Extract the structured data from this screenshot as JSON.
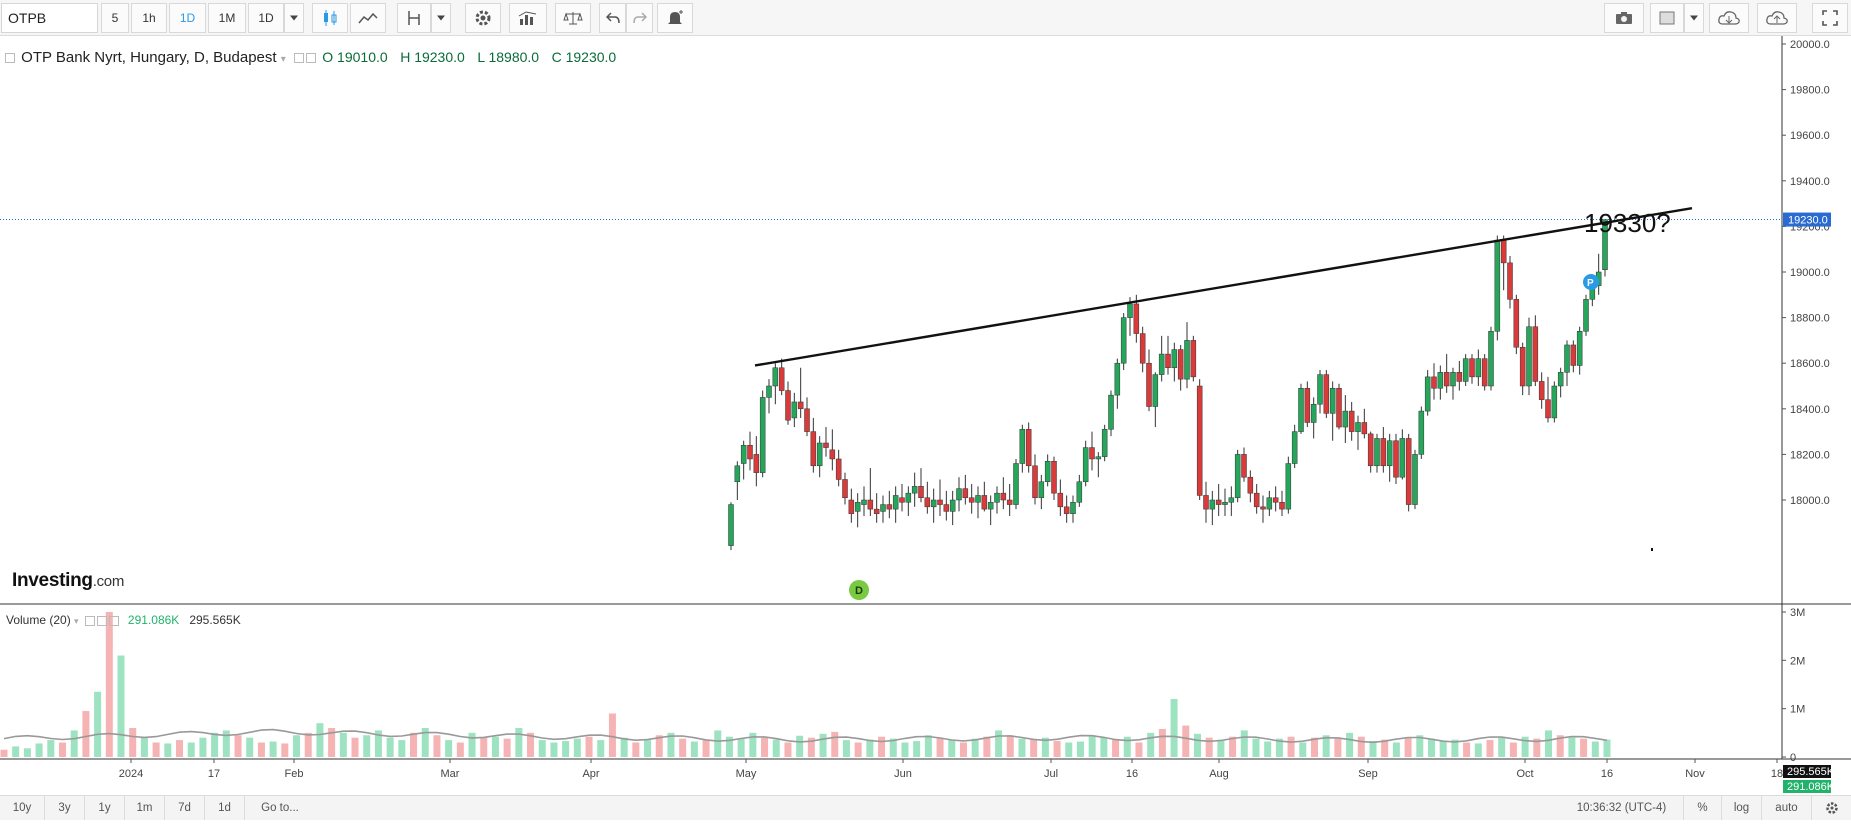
{
  "toolbar": {
    "symbol": "OTPB",
    "intervals": [
      "5",
      "1h",
      "1D",
      "1M",
      "1D"
    ],
    "active_interval": "1D"
  },
  "legend": {
    "title": "OTP Bank Nyrt, Hungary, D, Budapest",
    "open": "O 19010.0",
    "high": "H 19230.0",
    "low": "L 18980.0",
    "close": "C 19230.0"
  },
  "volume_legend": {
    "label": "Volume (20)",
    "value1": "291.086K",
    "value2": "295.565K"
  },
  "logo": {
    "main": "Investing",
    "suffix": ".com"
  },
  "annotation": "19330?",
  "bottombar": {
    "ranges": [
      "10y",
      "3y",
      "1y",
      "1m",
      "7d",
      "1d"
    ],
    "goto": "Go to...",
    "time": "10:36:32 (UTC-4)",
    "percent": "%",
    "log": "log",
    "auto": "auto"
  },
  "colors": {
    "up": "#26a65b",
    "down": "#d93b3b",
    "vol_up": "#9de3c1",
    "vol_down": "#f5b3b3",
    "current": "#2a6bd1"
  },
  "chart_data": {
    "type": "candlestick",
    "y_ticks": [
      "20000.0",
      "19800.0",
      "19600.0",
      "19400.0",
      "19200.0",
      "19000.0",
      "18800.0",
      "18600.0",
      "18400.0",
      "18200.0",
      "18000.0"
    ],
    "ylim": [
      17940,
      20050
    ],
    "current_price": "19230.0",
    "x_labels": [
      "2024",
      "17",
      "Feb",
      "Mar",
      "Apr",
      "May",
      "Jun",
      "Jul",
      "16",
      "Aug",
      "Sep",
      "Oct",
      "16",
      "Nov",
      "18"
    ],
    "volume_ticks": [
      "3M",
      "2M",
      "1M",
      "0"
    ],
    "volume_current": [
      "295.565K",
      "291.086K"
    ],
    "trendline": [
      [
        18590,
        0
      ],
      [
        19280,
        1
      ]
    ],
    "candles": [
      [
        17800,
        17990,
        17780,
        17980
      ],
      [
        18080,
        18170,
        18000,
        18150
      ],
      [
        18160,
        18260,
        18090,
        18240
      ],
      [
        18240,
        18300,
        18130,
        18180
      ],
      [
        18200,
        18280,
        18060,
        18120
      ],
      [
        18120,
        18480,
        18100,
        18450
      ],
      [
        18450,
        18530,
        18380,
        18500
      ],
      [
        18500,
        18600,
        18420,
        18580
      ],
      [
        18580,
        18620,
        18460,
        18480
      ],
      [
        18480,
        18520,
        18330,
        18350
      ],
      [
        18360,
        18470,
        18320,
        18430
      ],
      [
        18430,
        18580,
        18360,
        18400
      ],
      [
        18400,
        18450,
        18280,
        18300
      ],
      [
        18300,
        18360,
        18120,
        18150
      ],
      [
        18150,
        18280,
        18100,
        18250
      ],
      [
        18250,
        18320,
        18190,
        18230
      ],
      [
        18220,
        18310,
        18130,
        18180
      ],
      [
        18180,
        18220,
        18060,
        18090
      ],
      [
        18090,
        18120,
        17980,
        18010
      ],
      [
        18000,
        18050,
        17900,
        17940
      ],
      [
        17950,
        18030,
        17880,
        17990
      ],
      [
        17980,
        18060,
        17930,
        18000
      ],
      [
        18000,
        18140,
        17930,
        17960
      ],
      [
        17960,
        18030,
        17900,
        17940
      ],
      [
        17950,
        18020,
        17900,
        17980
      ],
      [
        17980,
        18040,
        17920,
        17960
      ],
      [
        17960,
        18060,
        17900,
        18020
      ],
      [
        18010,
        18070,
        17950,
        17990
      ],
      [
        17990,
        18060,
        17930,
        18030
      ],
      [
        18030,
        18120,
        17970,
        18060
      ],
      [
        18060,
        18140,
        17990,
        18010
      ],
      [
        18010,
        18080,
        17940,
        17970
      ],
      [
        17970,
        18050,
        17900,
        18000
      ],
      [
        18000,
        18090,
        17930,
        17980
      ],
      [
        17980,
        18040,
        17910,
        17950
      ],
      [
        17950,
        18040,
        17890,
        18000
      ],
      [
        18000,
        18100,
        17950,
        18050
      ],
      [
        18050,
        18110,
        17980,
        18010
      ],
      [
        18010,
        18070,
        17940,
        17990
      ],
      [
        17990,
        18060,
        17920,
        18020
      ],
      [
        18020,
        18080,
        17950,
        17960
      ],
      [
        17960,
        18020,
        17890,
        17990
      ],
      [
        17990,
        18060,
        17940,
        18030
      ],
      [
        18030,
        18100,
        17960,
        18000
      ],
      [
        18000,
        18070,
        17930,
        17980
      ],
      [
        17980,
        18180,
        17960,
        18160
      ],
      [
        18160,
        18330,
        18120,
        18310
      ],
      [
        18310,
        18340,
        18120,
        18150
      ],
      [
        18150,
        18200,
        17980,
        18010
      ],
      [
        18010,
        18110,
        17960,
        18080
      ],
      [
        18080,
        18200,
        18060,
        18170
      ],
      [
        18170,
        18190,
        18000,
        18030
      ],
      [
        18030,
        18090,
        17930,
        17970
      ],
      [
        17970,
        18020,
        17900,
        17940
      ],
      [
        17940,
        18020,
        17900,
        17990
      ],
      [
        17990,
        18110,
        17970,
        18080
      ],
      [
        18080,
        18260,
        18060,
        18230
      ],
      [
        18230,
        18300,
        18130,
        18180
      ],
      [
        18180,
        18210,
        18100,
        18190
      ],
      [
        18190,
        18330,
        18170,
        18310
      ],
      [
        18310,
        18480,
        18280,
        18460
      ],
      [
        18460,
        18620,
        18400,
        18600
      ],
      [
        18600,
        18820,
        18570,
        18800
      ],
      [
        18800,
        18890,
        18720,
        18860
      ],
      [
        18860,
        18900,
        18690,
        18730
      ],
      [
        18730,
        18760,
        18560,
        18600
      ],
      [
        18600,
        18660,
        18390,
        18410
      ],
      [
        18410,
        18560,
        18320,
        18550
      ],
      [
        18550,
        18720,
        18520,
        18640
      ],
      [
        18640,
        18720,
        18550,
        18580
      ],
      [
        18580,
        18690,
        18520,
        18660
      ],
      [
        18660,
        18680,
        18480,
        18530
      ],
      [
        18530,
        18780,
        18490,
        18700
      ],
      [
        18700,
        18720,
        18520,
        18540
      ],
      [
        18500,
        18530,
        18000,
        18020
      ],
      [
        18020,
        18080,
        17900,
        17960
      ],
      [
        17960,
        18040,
        17890,
        18000
      ],
      [
        18000,
        18070,
        17930,
        17980
      ],
      [
        17980,
        18050,
        17930,
        17990
      ],
      [
        17990,
        18060,
        17930,
        18010
      ],
      [
        18010,
        18220,
        17990,
        18200
      ],
      [
        18200,
        18230,
        18080,
        18100
      ],
      [
        18100,
        18130,
        17990,
        18030
      ],
      [
        18030,
        18070,
        17940,
        17970
      ],
      [
        17970,
        18020,
        17900,
        17960
      ],
      [
        17960,
        18040,
        17930,
        18010
      ],
      [
        18010,
        18060,
        17950,
        17990
      ],
      [
        17990,
        18040,
        17930,
        17960
      ],
      [
        17960,
        18190,
        17940,
        18160
      ],
      [
        18160,
        18330,
        18140,
        18300
      ],
      [
        18300,
        18510,
        18290,
        18490
      ],
      [
        18490,
        18520,
        18320,
        18340
      ],
      [
        18340,
        18450,
        18270,
        18420
      ],
      [
        18420,
        18570,
        18380,
        18550
      ],
      [
        18550,
        18570,
        18360,
        18380
      ],
      [
        18380,
        18520,
        18260,
        18490
      ],
      [
        18490,
        18510,
        18310,
        18320
      ],
      [
        18320,
        18460,
        18250,
        18390
      ],
      [
        18390,
        18430,
        18260,
        18300
      ],
      [
        18300,
        18370,
        18220,
        18340
      ],
      [
        18340,
        18400,
        18270,
        18290
      ],
      [
        18290,
        18300,
        18120,
        18150
      ],
      [
        18150,
        18290,
        18120,
        18270
      ],
      [
        18270,
        18320,
        18120,
        18150
      ],
      [
        18150,
        18290,
        18080,
        18260
      ],
      [
        18260,
        18290,
        18070,
        18100
      ],
      [
        18100,
        18310,
        18090,
        18270
      ],
      [
        18270,
        18290,
        17950,
        17980
      ],
      [
        17980,
        18220,
        17960,
        18200
      ],
      [
        18200,
        18410,
        18180,
        18390
      ],
      [
        18390,
        18570,
        18370,
        18540
      ],
      [
        18540,
        18600,
        18440,
        18490
      ],
      [
        18490,
        18590,
        18440,
        18560
      ],
      [
        18560,
        18640,
        18470,
        18500
      ],
      [
        18500,
        18580,
        18440,
        18560
      ],
      [
        18560,
        18610,
        18480,
        18520
      ],
      [
        18520,
        18640,
        18500,
        18620
      ],
      [
        18620,
        18640,
        18510,
        18540
      ],
      [
        18540,
        18660,
        18500,
        18620
      ],
      [
        18620,
        18640,
        18480,
        18500
      ],
      [
        18500,
        18760,
        18480,
        18740
      ],
      [
        18740,
        19160,
        18700,
        19140
      ],
      [
        19140,
        19160,
        18920,
        19040
      ],
      [
        19040,
        19070,
        18840,
        18880
      ],
      [
        18880,
        18900,
        18640,
        18670
      ],
      [
        18670,
        18690,
        18460,
        18500
      ],
      [
        18500,
        18800,
        18460,
        18760
      ],
      [
        18760,
        18810,
        18500,
        18520
      ],
      [
        18520,
        18560,
        18400,
        18440
      ],
      [
        18440,
        18540,
        18340,
        18360
      ],
      [
        18360,
        18520,
        18340,
        18500
      ],
      [
        18500,
        18580,
        18450,
        18560
      ],
      [
        18560,
        18700,
        18500,
        18680
      ],
      [
        18680,
        18700,
        18560,
        18590
      ],
      [
        18590,
        18760,
        18550,
        18740
      ],
      [
        18740,
        18900,
        18720,
        18880
      ],
      [
        18880,
        18960,
        18850,
        18940
      ],
      [
        18940,
        19080,
        18900,
        19000
      ],
      [
        19010,
        19230,
        18980,
        19230
      ]
    ],
    "volumes": [
      0.15,
      0.22,
      0.18,
      0.28,
      0.35,
      0.3,
      0.55,
      0.95,
      1.35,
      3.0,
      2.1,
      0.6,
      0.4,
      0.3,
      0.28,
      0.35,
      0.3,
      0.4,
      0.5,
      0.55,
      0.45,
      0.4,
      0.3,
      0.32,
      0.28,
      0.45,
      0.5,
      0.7,
      0.6,
      0.5,
      0.4,
      0.45,
      0.55,
      0.4,
      0.35,
      0.5,
      0.6,
      0.45,
      0.35,
      0.3,
      0.5,
      0.4,
      0.42,
      0.38,
      0.6,
      0.5,
      0.35,
      0.3,
      0.33,
      0.38,
      0.42,
      0.35,
      0.9,
      0.4,
      0.3,
      0.35,
      0.45,
      0.5,
      0.38,
      0.32,
      0.35,
      0.55,
      0.42,
      0.38,
      0.5,
      0.4,
      0.36,
      0.3,
      0.44,
      0.4,
      0.48,
      0.52,
      0.35,
      0.3,
      0.36,
      0.42,
      0.38,
      0.3,
      0.33,
      0.45,
      0.4,
      0.36,
      0.3,
      0.38,
      0.42,
      0.55,
      0.45,
      0.38,
      0.36,
      0.4,
      0.33,
      0.3,
      0.32,
      0.45,
      0.4,
      0.36,
      0.42,
      0.3,
      0.5,
      0.58,
      1.2,
      0.65,
      0.48,
      0.4,
      0.36,
      0.42,
      0.55,
      0.38,
      0.32,
      0.38,
      0.42,
      0.3,
      0.4,
      0.45,
      0.38,
      0.5,
      0.42,
      0.33,
      0.36,
      0.3,
      0.4,
      0.45,
      0.38,
      0.33,
      0.36,
      0.3,
      0.28,
      0.35,
      0.4,
      0.3,
      0.42,
      0.38,
      0.55,
      0.45,
      0.4,
      0.38,
      0.32,
      0.36
    ],
    "vol_ma": [
      0.38,
      0.52,
      0.42,
      0.36,
      0.4,
      0.35,
      0.38
    ]
  }
}
